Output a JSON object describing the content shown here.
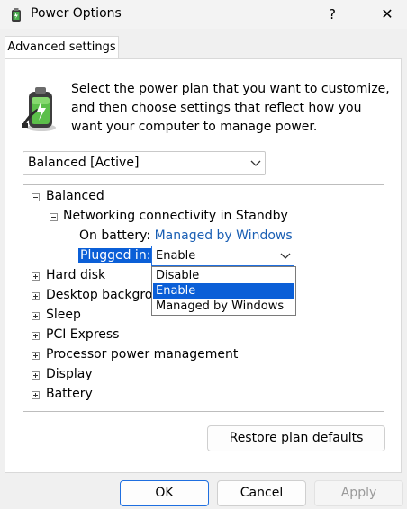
{
  "window": {
    "title": "Power Options",
    "help_label": "?",
    "close_label": "✕"
  },
  "tab": {
    "label": "Advanced settings"
  },
  "intro_text": "Select the power plan that you want to customize, and then choose settings that reflect how you want your computer to manage power.",
  "plan_select": {
    "value": "Balanced [Active]"
  },
  "tree": {
    "balanced": "Balanced",
    "networking": "Networking connectivity in Standby",
    "on_battery_label": "On battery:",
    "on_battery_value": "Managed by Windows",
    "plugged_in_label": "Plugged in:",
    "plugged_in_value": "Enable",
    "options": [
      "Disable",
      "Enable",
      "Managed by Windows"
    ],
    "items": [
      "Hard disk",
      "Desktop backgrou",
      "Sleep",
      "PCI Express",
      "Processor power management",
      "Display",
      "Battery"
    ]
  },
  "buttons": {
    "restore": "Restore plan defaults",
    "ok": "OK",
    "cancel": "Cancel",
    "apply": "Apply"
  },
  "colors": {
    "accent": "#0b5fd7",
    "link": "#1a5fb4"
  }
}
